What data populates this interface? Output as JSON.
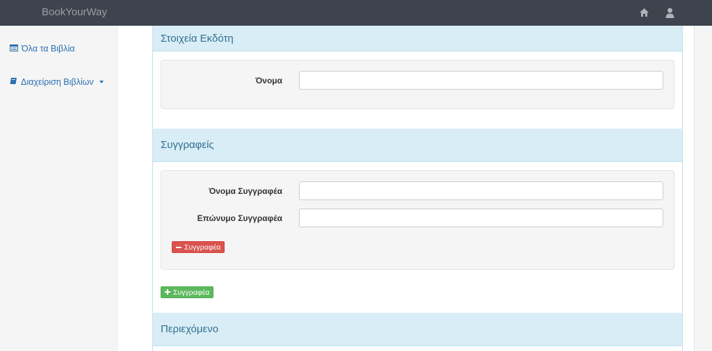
{
  "app": {
    "brand": "BookYourWay"
  },
  "navbar": {
    "icons": [
      "home-icon",
      "user-icon"
    ]
  },
  "sidebar": {
    "items": [
      {
        "label": "Όλα τα Βιβλία",
        "icon": "list-icon"
      },
      {
        "label": "Διαχείριση Βιβλίων",
        "icon": "book-icon"
      }
    ]
  },
  "publisher": {
    "title": "Στοιχεία Εκδότη",
    "name_label": "Όνομα",
    "name_value": ""
  },
  "authors": {
    "title": "Συγγραφείς",
    "first_name_label": "Όνομα Συγγραφέα",
    "first_name_value": "",
    "last_name_label": "Επώνυμο Συγγραφέα",
    "last_name_value": "",
    "remove_label": "Συγγραφέα",
    "add_label": "Συγγραφέα"
  },
  "content": {
    "title": "Περιεχόμενο"
  },
  "colors": {
    "navbar": "#3d444d",
    "panel_heading": "#d9edf7",
    "danger": "#d9534f",
    "success": "#5cb85c",
    "link": "#2a6fb0"
  }
}
